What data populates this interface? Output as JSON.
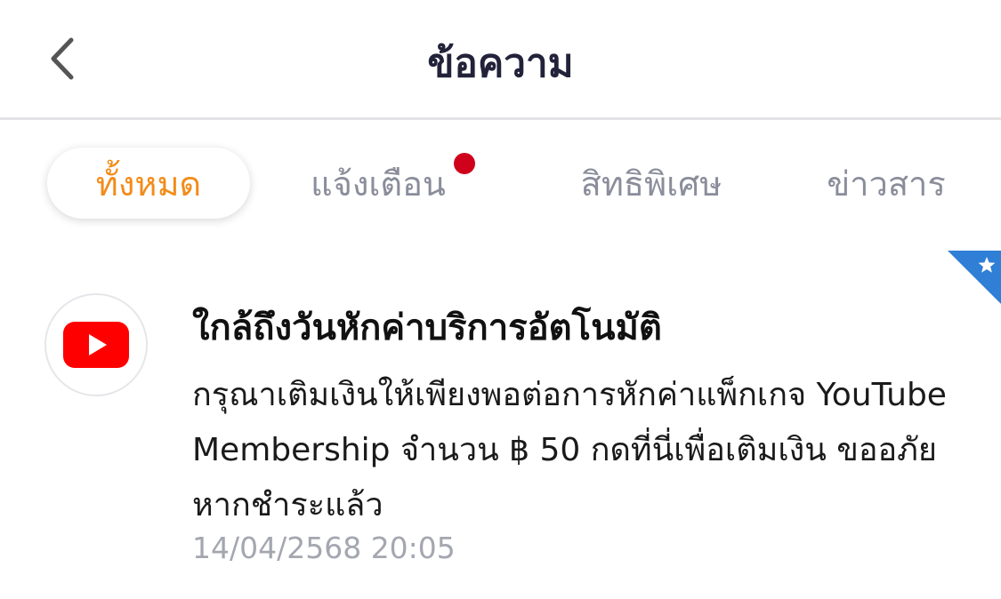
{
  "header": {
    "title": "ข้อความ",
    "back_icon": "chevron-left-icon"
  },
  "tabs": [
    {
      "label": "ทั้งหมด",
      "active": true
    },
    {
      "label": "แจ้งเตือน",
      "active": false,
      "has_unread_dot": true
    },
    {
      "label": "สิทธิพิเศษ",
      "active": false
    },
    {
      "label": "ข่าวสาร",
      "active": false
    }
  ],
  "messages": [
    {
      "icon": "youtube-icon",
      "title": "ใกล้ถึงวันหักค่าบริการอัตโนมัติ",
      "body": "กรุณาเติมเงินให้เพียงพอต่อการหักค่าแพ็กเกจ YouTube Membership จำนวน ฿ 50 กดที่นี่เพื่อเติมเงิน ขออภัยหากชำระแล้ว",
      "timestamp": "14/04/2568 20:05",
      "badge_icon": "star-icon"
    }
  ],
  "colors": {
    "accent": "#f28c1a",
    "unread_dot": "#d0021b",
    "badge": "#2f7fd6",
    "youtube_red": "#ff0000"
  }
}
